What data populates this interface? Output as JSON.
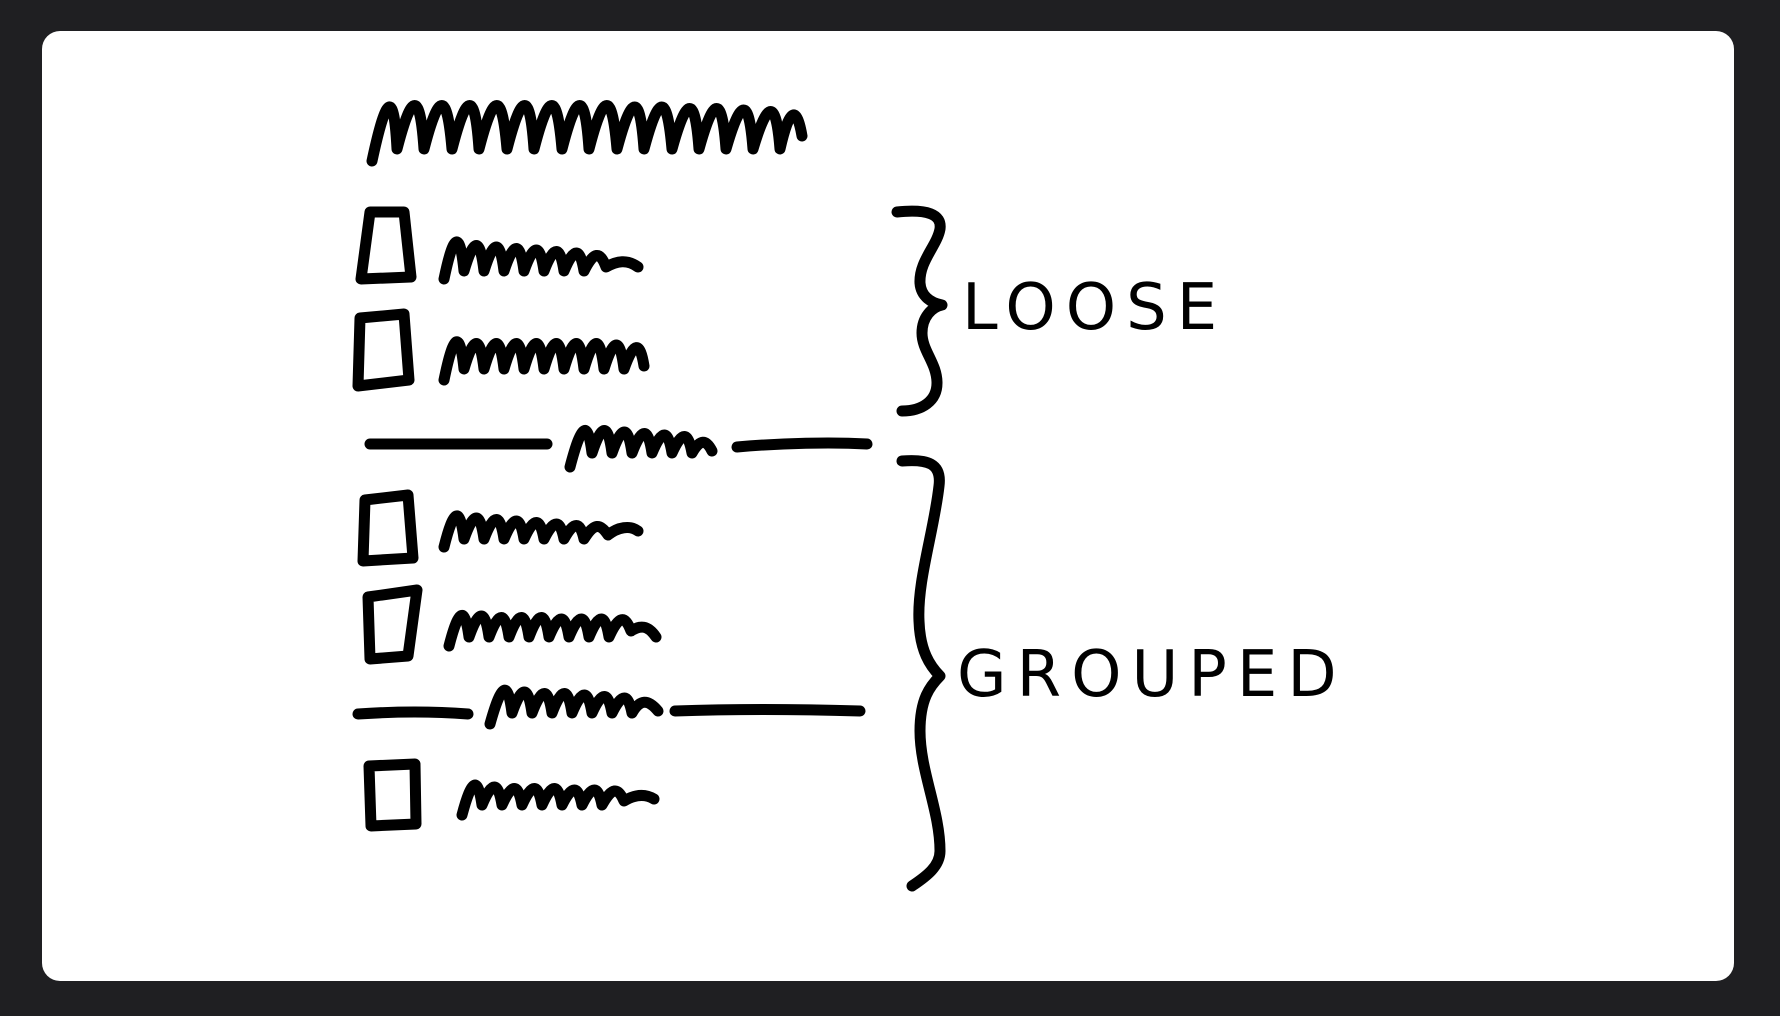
{
  "labels": {
    "loose": "LOOSE",
    "grouped": "GROUPED"
  },
  "colors": {
    "background": "#1f1f22",
    "card": "#ffffff",
    "ink": "#000000"
  }
}
